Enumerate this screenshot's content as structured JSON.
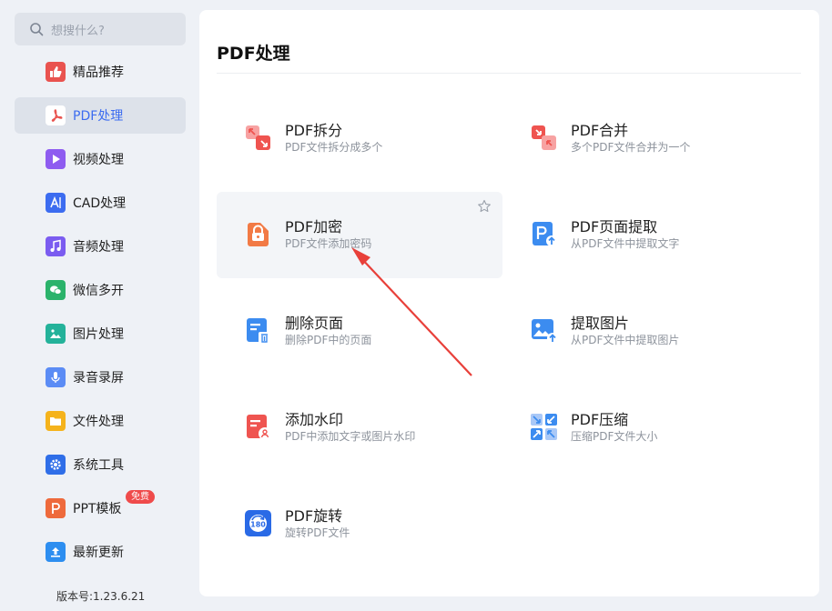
{
  "search": {
    "placeholder": "想搜什么?"
  },
  "sidebar": {
    "items": [
      {
        "label": "精品推荐",
        "icon": "thumbs-up-icon",
        "color": "#e9534f"
      },
      {
        "label": "PDF处理",
        "icon": "pdf-icon",
        "color": "#e9534f",
        "active": true
      },
      {
        "label": "视频处理",
        "icon": "play-icon",
        "color": "#8e5cf0"
      },
      {
        "label": "CAD处理",
        "icon": "cad-icon",
        "color": "#3c6cf0"
      },
      {
        "label": "音频处理",
        "icon": "music-note-icon",
        "color": "#7b5cf0"
      },
      {
        "label": "微信多开",
        "icon": "wechat-icon",
        "color": "#2bb36b"
      },
      {
        "label": "图片处理",
        "icon": "image-icon",
        "color": "#24b29a"
      },
      {
        "label": "录音录屏",
        "icon": "microphone-icon",
        "color": "#5b8cf5"
      },
      {
        "label": "文件处理",
        "icon": "folder-icon",
        "color": "#f5b31c"
      },
      {
        "label": "系统工具",
        "icon": "gear-icon",
        "color": "#2f6ee8"
      },
      {
        "label": "PPT模板",
        "icon": "ppt-icon",
        "color": "#ee6a3c",
        "badge": "免费"
      },
      {
        "label": "最新更新",
        "icon": "upload-icon",
        "color": "#2d8ef0"
      }
    ]
  },
  "version": "版本号:1.23.6.21",
  "main": {
    "title": "PDF处理",
    "tools": [
      {
        "title": "PDF拆分",
        "desc": "PDF文件拆分成多个",
        "icon": "split-icon"
      },
      {
        "title": "PDF合并",
        "desc": "多个PDF文件合并为一个",
        "icon": "merge-icon"
      },
      {
        "title": "PDF加密",
        "desc": "PDF文件添加密码",
        "icon": "lock-icon",
        "hovered": true
      },
      {
        "title": "PDF页面提取",
        "desc": "从PDF文件中提取文字",
        "icon": "page-extract-icon"
      },
      {
        "title": "删除页面",
        "desc": "删除PDF中的页面",
        "icon": "delete-page-icon"
      },
      {
        "title": "提取图片",
        "desc": "从PDF文件中提取图片",
        "icon": "extract-image-icon"
      },
      {
        "title": "添加水印",
        "desc": "PDF中添加文字或图片水印",
        "icon": "watermark-icon"
      },
      {
        "title": "PDF压缩",
        "desc": "压缩PDF文件大小",
        "icon": "compress-icon"
      },
      {
        "title": "PDF旋转",
        "desc": "旋转PDF文件",
        "icon": "rotate-icon"
      }
    ]
  },
  "colors": {
    "accent": "#3c6cf0",
    "arrow": "#e8403a"
  }
}
